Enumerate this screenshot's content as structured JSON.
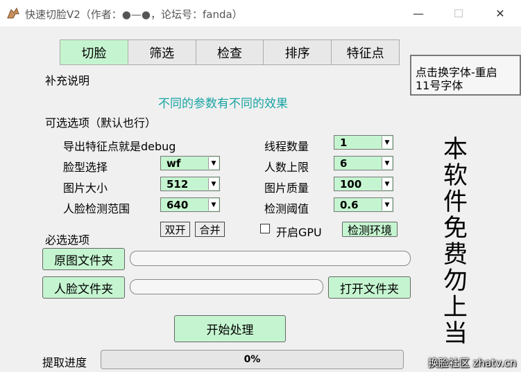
{
  "window": {
    "title": "快速切脸V2（作者：●—●，论坛号：fanda）",
    "min_glyph": "—",
    "max_glyph": "☐",
    "close_glyph": "✕"
  },
  "tabs": [
    {
      "label": "切脸",
      "active": true
    },
    {
      "label": "筛选",
      "active": false
    },
    {
      "label": "检查",
      "active": false
    },
    {
      "label": "排序",
      "active": false
    },
    {
      "label": "特征点",
      "active": false
    }
  ],
  "font_box": {
    "line1": "点击换字体-重启",
    "line2": "11号字体"
  },
  "notes": {
    "heading": "补充说明",
    "tip": "不同的参数有不同的效果"
  },
  "optional": {
    "heading": "可选选项（默认也行）",
    "export_label": "导出特征点就是debug",
    "face_type_label": "脸型选择",
    "face_type_value": "wf",
    "image_size_label": "图片大小",
    "image_size_value": "512",
    "detect_range_label": "人脸检测范围",
    "detect_range_value": "640",
    "threads_label": "线程数量",
    "threads_value": "1",
    "people_limit_label": "人数上限",
    "people_limit_value": "6",
    "quality_label": "图片质量",
    "quality_value": "100",
    "threshold_label": "检测阈值",
    "threshold_value": "0.6",
    "dual_btn": "双开",
    "merge_btn": "合并",
    "gpu_label": "开启GPU",
    "env_btn": "检测环境"
  },
  "required": {
    "heading": "必选选项",
    "src_btn": "原图文件夹",
    "face_btn": "人脸文件夹",
    "open_btn": "打开文件夹"
  },
  "actions": {
    "start_btn": "开始处理"
  },
  "progress": {
    "label": "提取进度",
    "value_text": "0%",
    "fraction": 0
  },
  "side_text": [
    "本",
    "软",
    "件",
    "免",
    "费",
    "勿",
    "上",
    "当"
  ],
  "watermark": "换脸社区 zhatv.cn"
}
